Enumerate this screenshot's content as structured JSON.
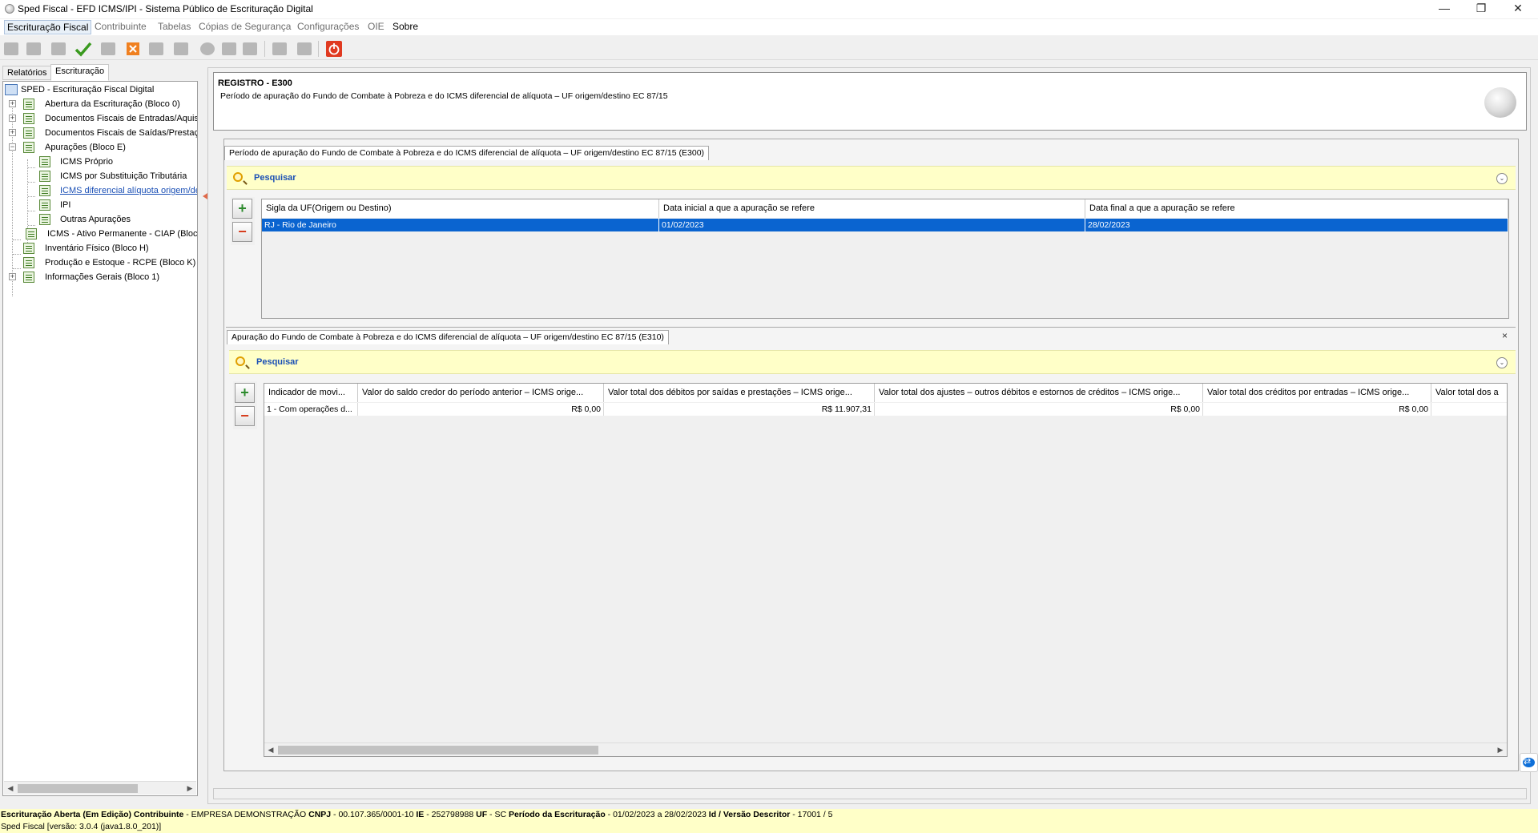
{
  "window": {
    "title": "Sped Fiscal - EFD ICMS/IPI - Sistema Público de Escrituração Digital",
    "minimize_glyph": "—",
    "restore_glyph": "❐",
    "close_glyph": "✕"
  },
  "menu": [
    "Escrituração Fiscal",
    "Contribuinte",
    "Tabelas",
    "Cópias de Segurança",
    "Configurações",
    "OIE",
    "Sobre"
  ],
  "toolbar": {
    "icons": [
      "new-document-icon",
      "open-icon",
      "folder-icon",
      "validate-check-icon",
      "copy-icon",
      "delete-icon",
      "export-icon",
      "import-icon",
      "globe-icon",
      "sign-icon",
      "shield-icon",
      "save-icon",
      "save-all-icon",
      "power-icon"
    ],
    "colors": {
      "check": "#3a9a1f",
      "delete": "#f08020",
      "power": "#e03a20"
    }
  },
  "left_tabs": [
    "Relatórios",
    "Escrituração"
  ],
  "tree": {
    "root": "SPED - Escrituração Fiscal Digital",
    "items": [
      {
        "label": "Abertura da Escrituração (Bloco 0)",
        "expander": "+"
      },
      {
        "label": "Documentos Fiscais de Entradas/Aquisi",
        "expander": "+"
      },
      {
        "label": "Documentos Fiscais de Saídas/Prestaçã",
        "expander": "+"
      },
      {
        "label": "Apurações (Bloco E)",
        "expander": "−"
      },
      {
        "label": "ICMS Próprio"
      },
      {
        "label": "ICMS por Substituição Tributária"
      },
      {
        "label": "ICMS diferencial alíquota origem/des"
      },
      {
        "label": "IPI"
      },
      {
        "label": "Outras Apurações"
      },
      {
        "label": "ICMS - Ativo Permanente - CIAP (Bloco"
      },
      {
        "label": "Inventário Físico (Bloco H)"
      },
      {
        "label": "Produção e Estoque - RCPE (Bloco K)"
      },
      {
        "label": "Informações Gerais (Bloco 1)",
        "expander": "+"
      }
    ]
  },
  "header": {
    "title": "REGISTRO - E300",
    "description": "Período de apuração do Fundo de Combate à Pobreza e do ICMS diferencial de alíquota – UF origem/destino EC 87/15"
  },
  "panel_e300": {
    "tab": "Período de apuração do Fundo de Combate à Pobreza e do ICMS diferencial de alíquota – UF origem/destino EC 87/15 (E300)",
    "search_label": "Pesquisar",
    "columns": [
      "Sigla da UF(Origem ou Destino)",
      "Data inicial a que a apuração se refere",
      "Data final a que a apuração se refere"
    ],
    "rows": [
      [
        "RJ - Rio de Janeiro",
        "01/02/2023",
        "28/02/2023"
      ]
    ]
  },
  "panel_e310": {
    "tab": "Apuração do Fundo de Combate à Pobreza e do ICMS diferencial de alíquota – UF origem/destino EC 87/15 (E310)",
    "search_label": "Pesquisar",
    "close_glyph": "×",
    "columns": [
      "Indicador de movi...",
      "Valor do saldo credor do período anterior – ICMS orige...",
      "Valor total dos débitos por saídas e prestações – ICMS orige...",
      "Valor total dos ajustes – outros débitos e estornos de créditos – ICMS orige...",
      "Valor total dos créditos por entradas – ICMS orige...",
      "Valor total dos a"
    ],
    "rows": [
      [
        "1 - Com operações d...",
        "R$ 0,00",
        "R$ 11.907,31",
        "R$ 0,00",
        "R$ 0,00",
        ""
      ]
    ]
  },
  "buttons": {
    "add": "+",
    "remove": "−",
    "collapse": "⌄"
  },
  "status": {
    "line1": [
      {
        "b": "Escrituração Aberta (Em Edição) Contribuinte",
        "t": " - EMPRESA DEMONSTRAÇÃO "
      },
      {
        "b": "CNPJ",
        "t": " - 00.107.365/0001-10 "
      },
      {
        "b": "IE",
        "t": " - 252798988 "
      },
      {
        "b": "UF",
        "t": " - SC "
      },
      {
        "b": "Período da Escrituração",
        "t": " - 01/02/2023 a 28/02/2023 "
      },
      {
        "b": "Id / Versão Descritor",
        "t": " - 17001 / 5"
      }
    ],
    "line2": "Sped Fiscal [versão: 3.0.4 (java1.8.0_201)]"
  },
  "accent_colors": {
    "selection": "#0a64d0",
    "search_bg": "#ffffc8",
    "link": "#1a4fb5",
    "arrow": "#e06a4a"
  }
}
